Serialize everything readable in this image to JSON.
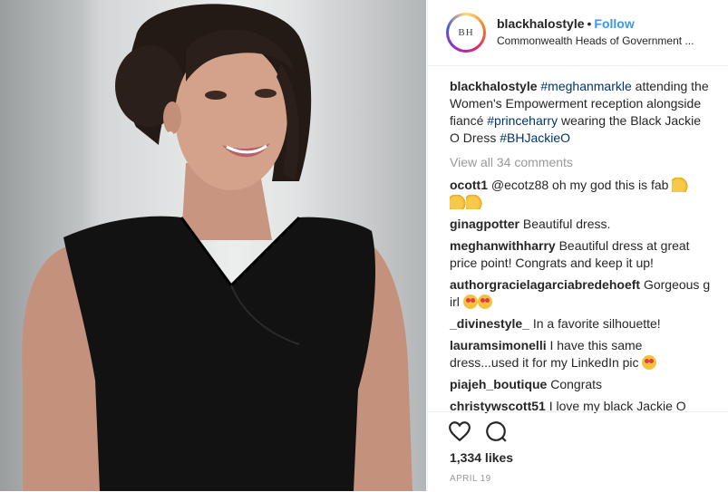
{
  "post": {
    "photo_icon": "photo-person-black-dress",
    "avatar_initials": "BH",
    "username": "blackhalostyle",
    "separator": "•",
    "follow_label": "Follow",
    "location": "Commonwealth Heads of Government ...",
    "caption": {
      "username": "blackhalostyle",
      "parts": [
        " ",
        "#meghanmarkle",
        " attending the Women's Empowerment reception alongside fiancé ",
        "#princeharry",
        " wearing the Black Jackie O Dress ",
        "#BHJackieO"
      ]
    },
    "view_all": "View all 34 comments",
    "comments": [
      {
        "user": "ocott1",
        "text": "@ecotz88 oh my god this is fab"
      },
      {
        "user": "ginagpotter",
        "text": "Beautiful dress."
      },
      {
        "user": "meghanwithharry",
        "text": "Beautiful dress at great price point! Congrats and keep it up!"
      },
      {
        "user": "authorgracielagarciabredehoeft",
        "text": "Gorgeous girl"
      },
      {
        "user": "_divinestyle_",
        "text": "In a favorite silhouette!"
      },
      {
        "user": "lauramsimonelli",
        "text": "I have this same dress...used it for my LinkedIn pic"
      },
      {
        "user": "piajeh_boutique",
        "text": "Congrats"
      },
      {
        "user": "christywscott51",
        "text": "I love my black Jackie O"
      }
    ],
    "likes": "1,334 likes",
    "date": "APRIL 19",
    "icons": [
      "heart-icon",
      "comment-icon"
    ]
  }
}
